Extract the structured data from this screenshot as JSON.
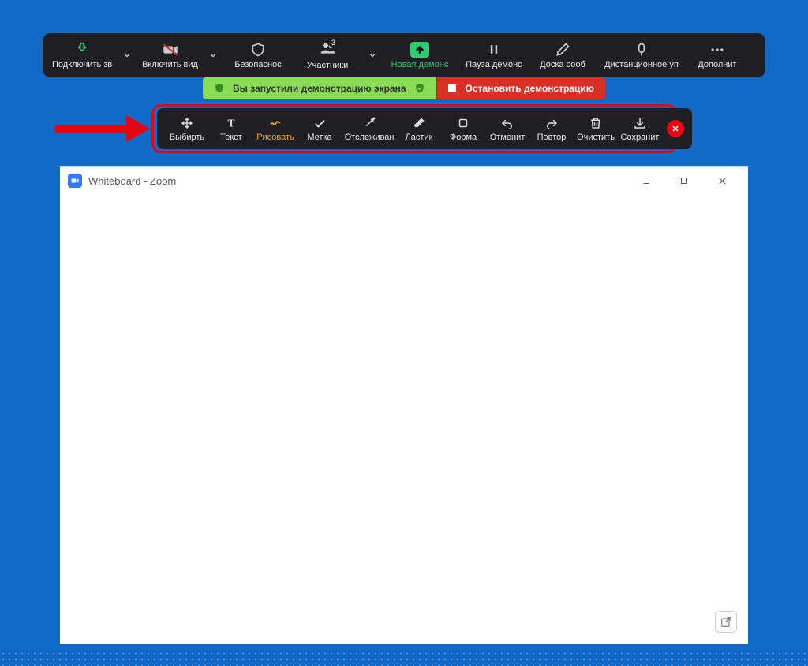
{
  "toolbar": {
    "audio": "Подключить зв",
    "video": "Включить вид",
    "security": "Безопаснос",
    "participants": "Участники",
    "participants_count": "3",
    "new_share": "Новая демонс",
    "pause_share": "Пауза демонс",
    "whiteboard": "Доска сооб",
    "remote_control": "Дистанционное уп",
    "more": "Дополнит"
  },
  "status": {
    "sharing_text": "Вы запустили демонстрацию экрана",
    "stop_text": "Остановить демонстрацию"
  },
  "annotate": {
    "select": "Выбирть",
    "text": "Текст",
    "draw": "Рисовать",
    "stamp": "Метка",
    "spotlight": "Отслеживан",
    "eraser": "Ластик",
    "format": "Форма",
    "undo": "Отменит",
    "redo": "Повтор",
    "clear": "Очистить",
    "save": "Сохранит"
  },
  "window": {
    "title": "Whiteboard - Zoom"
  },
  "colors": {
    "accent_green": "#2ecc71",
    "accent_red": "#e30613",
    "accent_orange": "#f6a623"
  }
}
